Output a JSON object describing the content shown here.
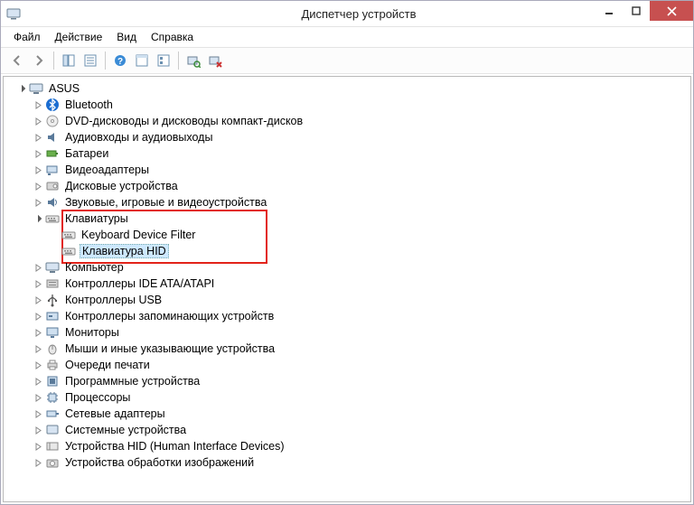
{
  "window": {
    "title": "Диспетчер устройств"
  },
  "menu": {
    "file": "Файл",
    "action": "Действие",
    "view": "Вид",
    "help": "Справка"
  },
  "tree": {
    "root": "ASUS",
    "bluetooth": "Bluetooth",
    "dvd": "DVD-дисководы и дисководы компакт-дисков",
    "audio": "Аудиовходы и аудиовыходы",
    "battery": "Батареи",
    "video": "Видеоадаптеры",
    "disk": "Дисковые устройства",
    "sound": "Звуковые, игровые и видеоустройства",
    "keyboards": "Клавиатуры",
    "keyboard_filter": "Keyboard Device Filter",
    "keyboard_hid": "Клавиатура HID",
    "computer": "Компьютер",
    "ide": "Контроллеры IDE ATA/ATAPI",
    "usb": "Контроллеры USB",
    "storage_ctrl": "Контроллеры запоминающих устройств",
    "monitors": "Мониторы",
    "mouse": "Мыши и иные указывающие устройства",
    "print_queues": "Очереди печати",
    "firmware": "Программные устройства",
    "processors": "Процессоры",
    "net": "Сетевые адаптеры",
    "system": "Системные устройства",
    "hid": "Устройства HID (Human Interface Devices)",
    "imaging": "Устройства обработки изображений"
  }
}
